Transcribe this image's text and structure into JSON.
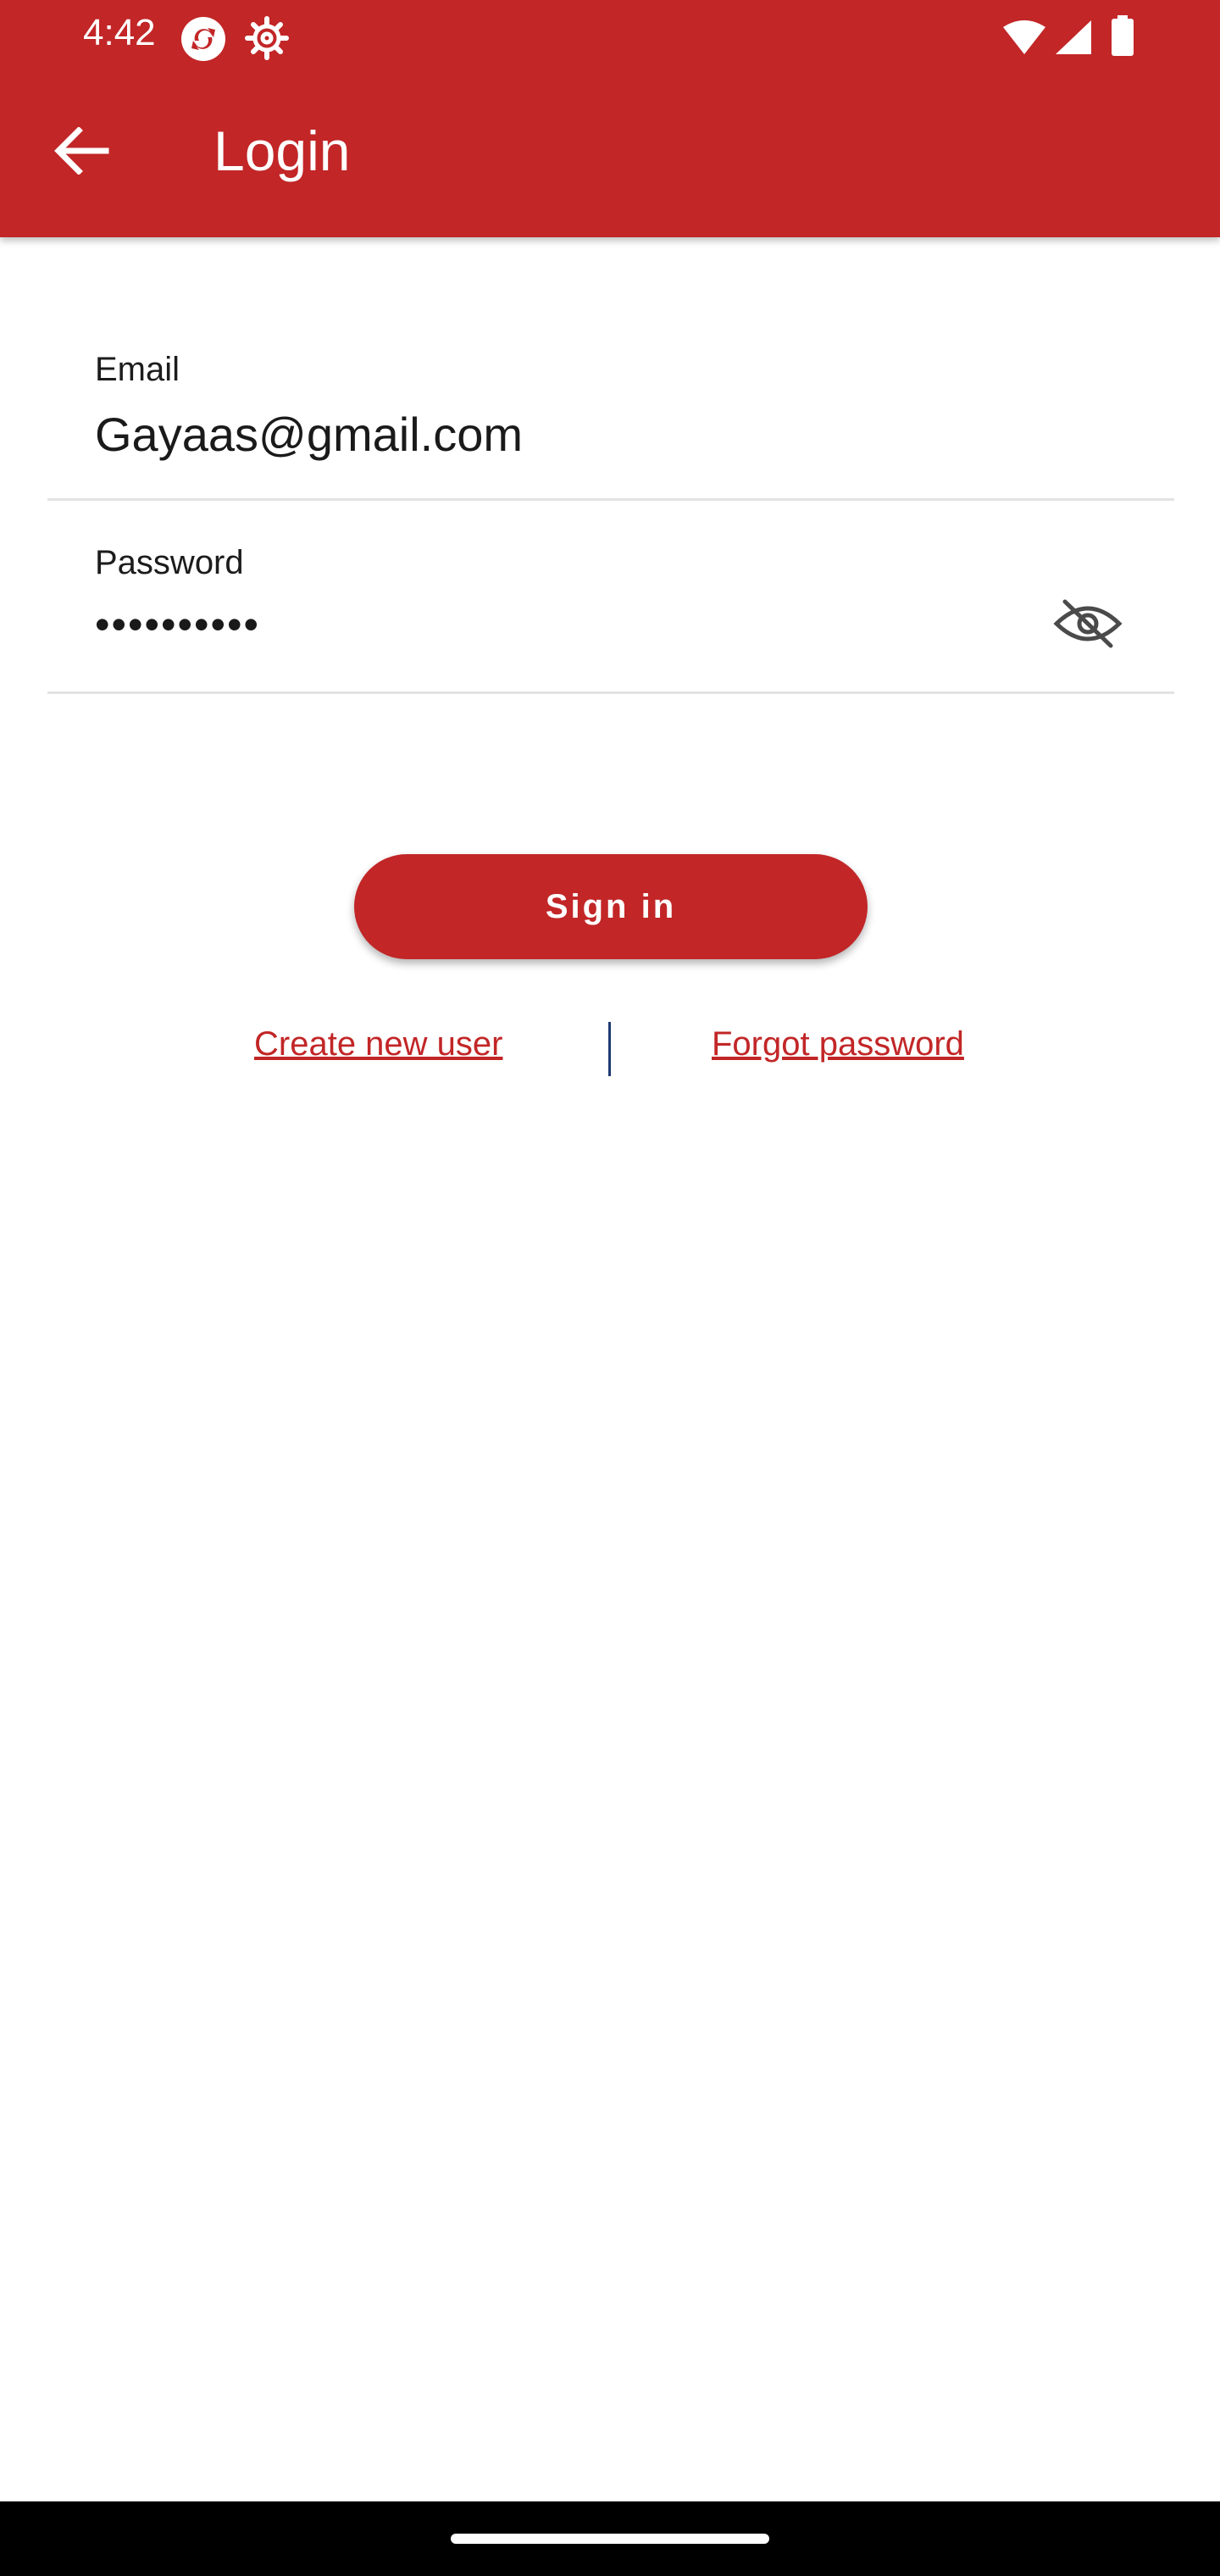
{
  "status_bar": {
    "time": "4:42",
    "icons": [
      "sync-icon",
      "settings-gear-icon",
      "wifi-icon",
      "signal-icon",
      "battery-icon"
    ]
  },
  "app_bar": {
    "title": "Login",
    "back_icon": "arrow-back-icon"
  },
  "form": {
    "email_label": "Email",
    "email_value": "Gayaas@gmail.com",
    "password_label": "Password",
    "password_value": "••••••••••",
    "visibility_icon": "visibility-off-icon"
  },
  "actions": {
    "sign_in_label": "Sign in",
    "create_user_label": "Create new user",
    "forgot_password_label": "Forgot password"
  },
  "colors": {
    "primary": "#c22627",
    "divider": "#1f3b73"
  }
}
